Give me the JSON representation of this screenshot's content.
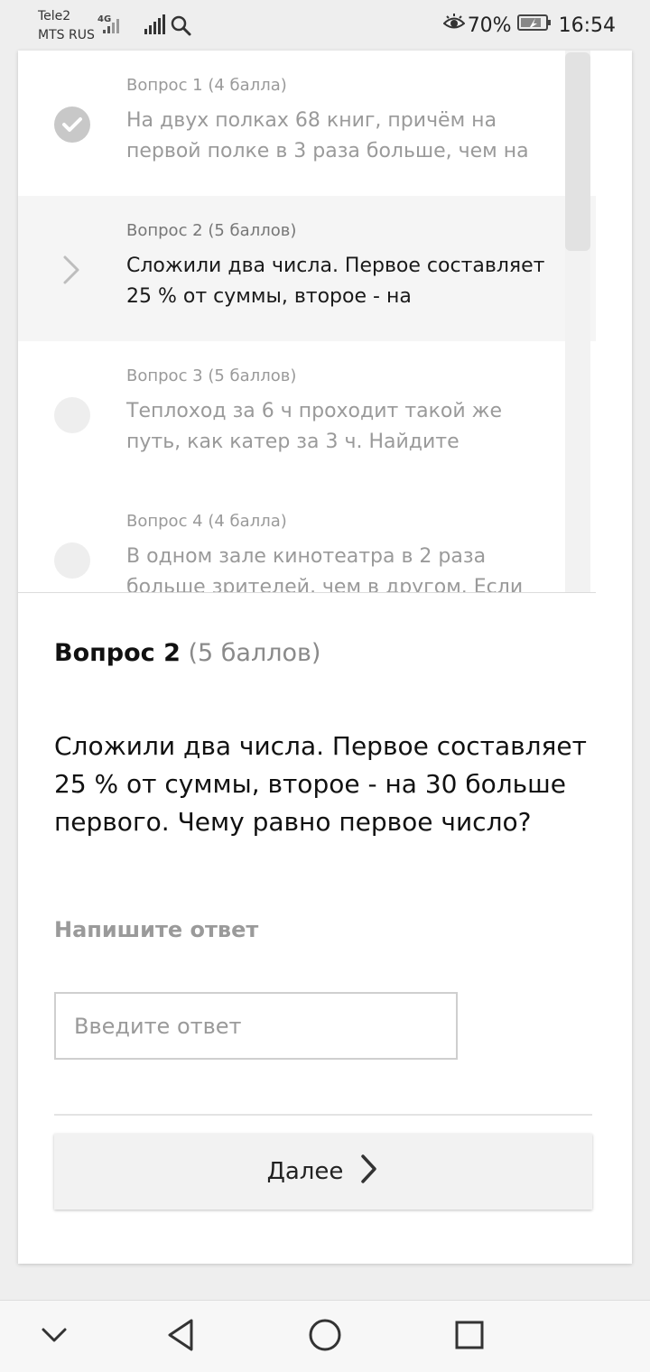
{
  "status_bar": {
    "carrier_1": "Tele2",
    "carrier_2": "MTS RUS",
    "network_type": "4G",
    "battery": "70%",
    "time": "16:54",
    "icons": [
      "signal-4g-icon",
      "signal-icon",
      "search-icon",
      "eye-comfort-icon",
      "battery-icon"
    ]
  },
  "question_list": [
    {
      "meta": "Вопрос 1 (4 балла)",
      "text": "На двух полках 68 книг, причём на первой полке в 3 раза больше, чем на",
      "status": "done",
      "icon": "check-icon"
    },
    {
      "meta": "Вопрос 2 (5 баллов)",
      "text": "Сложили два числа. Первое составляет 25 % от суммы, второе - на",
      "status": "current",
      "icon": "chevron-right-icon"
    },
    {
      "meta": "Вопрос 3 (5 баллов)",
      "text": "Теплоход за 6 ч проходит такой же путь, как катер за 3 ч. Найдите",
      "status": "pending",
      "icon": "empty-circle-icon"
    },
    {
      "meta": "Вопрос 4 (4 балла)",
      "text": "В одном зале кинотеатра в 2 раза больше зрителей, чем в другом. Если",
      "status": "pending",
      "icon": "empty-circle-icon"
    }
  ],
  "current_question": {
    "title": "Вопрос 2",
    "points": "(5 баллов)",
    "body": "Сложили два числа. Первое составляет 25 % от суммы, второе - на 30 больше первого. Чему равно первое число?",
    "answer_label": "Напишите ответ",
    "answer_placeholder": "Введите ответ",
    "answer_value": ""
  },
  "next_button": {
    "label": "Далее",
    "icon": "chevron-right-icon"
  },
  "nav_bar": {
    "icons": [
      "hide-keyboard-icon",
      "back-icon",
      "home-icon",
      "recents-icon"
    ]
  },
  "colors": {
    "accent_text": "#111111",
    "muted_text": "#9a9a9a",
    "card_bg": "#ffffff",
    "page_bg": "#eeeeee"
  }
}
